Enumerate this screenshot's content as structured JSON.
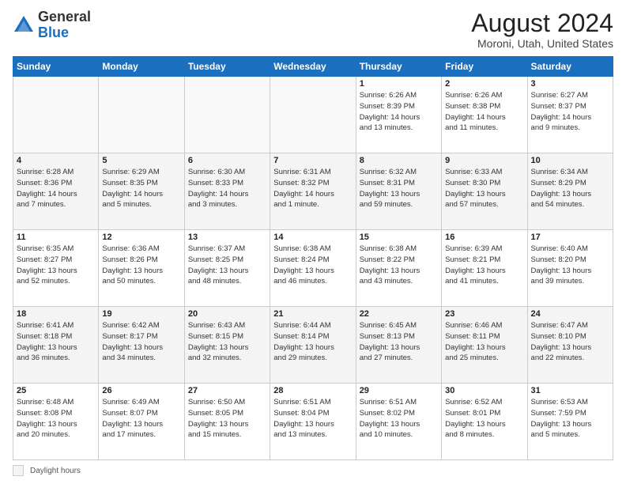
{
  "header": {
    "logo_general": "General",
    "logo_blue": "Blue",
    "month_year": "August 2024",
    "location": "Moroni, Utah, United States"
  },
  "days_of_week": [
    "Sunday",
    "Monday",
    "Tuesday",
    "Wednesday",
    "Thursday",
    "Friday",
    "Saturday"
  ],
  "weeks": [
    [
      {
        "day": "",
        "info": ""
      },
      {
        "day": "",
        "info": ""
      },
      {
        "day": "",
        "info": ""
      },
      {
        "day": "",
        "info": ""
      },
      {
        "day": "1",
        "info": "Sunrise: 6:26 AM\nSunset: 8:39 PM\nDaylight: 14 hours\nand 13 minutes."
      },
      {
        "day": "2",
        "info": "Sunrise: 6:26 AM\nSunset: 8:38 PM\nDaylight: 14 hours\nand 11 minutes."
      },
      {
        "day": "3",
        "info": "Sunrise: 6:27 AM\nSunset: 8:37 PM\nDaylight: 14 hours\nand 9 minutes."
      }
    ],
    [
      {
        "day": "4",
        "info": "Sunrise: 6:28 AM\nSunset: 8:36 PM\nDaylight: 14 hours\nand 7 minutes."
      },
      {
        "day": "5",
        "info": "Sunrise: 6:29 AM\nSunset: 8:35 PM\nDaylight: 14 hours\nand 5 minutes."
      },
      {
        "day": "6",
        "info": "Sunrise: 6:30 AM\nSunset: 8:33 PM\nDaylight: 14 hours\nand 3 minutes."
      },
      {
        "day": "7",
        "info": "Sunrise: 6:31 AM\nSunset: 8:32 PM\nDaylight: 14 hours\nand 1 minute."
      },
      {
        "day": "8",
        "info": "Sunrise: 6:32 AM\nSunset: 8:31 PM\nDaylight: 13 hours\nand 59 minutes."
      },
      {
        "day": "9",
        "info": "Sunrise: 6:33 AM\nSunset: 8:30 PM\nDaylight: 13 hours\nand 57 minutes."
      },
      {
        "day": "10",
        "info": "Sunrise: 6:34 AM\nSunset: 8:29 PM\nDaylight: 13 hours\nand 54 minutes."
      }
    ],
    [
      {
        "day": "11",
        "info": "Sunrise: 6:35 AM\nSunset: 8:27 PM\nDaylight: 13 hours\nand 52 minutes."
      },
      {
        "day": "12",
        "info": "Sunrise: 6:36 AM\nSunset: 8:26 PM\nDaylight: 13 hours\nand 50 minutes."
      },
      {
        "day": "13",
        "info": "Sunrise: 6:37 AM\nSunset: 8:25 PM\nDaylight: 13 hours\nand 48 minutes."
      },
      {
        "day": "14",
        "info": "Sunrise: 6:38 AM\nSunset: 8:24 PM\nDaylight: 13 hours\nand 46 minutes."
      },
      {
        "day": "15",
        "info": "Sunrise: 6:38 AM\nSunset: 8:22 PM\nDaylight: 13 hours\nand 43 minutes."
      },
      {
        "day": "16",
        "info": "Sunrise: 6:39 AM\nSunset: 8:21 PM\nDaylight: 13 hours\nand 41 minutes."
      },
      {
        "day": "17",
        "info": "Sunrise: 6:40 AM\nSunset: 8:20 PM\nDaylight: 13 hours\nand 39 minutes."
      }
    ],
    [
      {
        "day": "18",
        "info": "Sunrise: 6:41 AM\nSunset: 8:18 PM\nDaylight: 13 hours\nand 36 minutes."
      },
      {
        "day": "19",
        "info": "Sunrise: 6:42 AM\nSunset: 8:17 PM\nDaylight: 13 hours\nand 34 minutes."
      },
      {
        "day": "20",
        "info": "Sunrise: 6:43 AM\nSunset: 8:15 PM\nDaylight: 13 hours\nand 32 minutes."
      },
      {
        "day": "21",
        "info": "Sunrise: 6:44 AM\nSunset: 8:14 PM\nDaylight: 13 hours\nand 29 minutes."
      },
      {
        "day": "22",
        "info": "Sunrise: 6:45 AM\nSunset: 8:13 PM\nDaylight: 13 hours\nand 27 minutes."
      },
      {
        "day": "23",
        "info": "Sunrise: 6:46 AM\nSunset: 8:11 PM\nDaylight: 13 hours\nand 25 minutes."
      },
      {
        "day": "24",
        "info": "Sunrise: 6:47 AM\nSunset: 8:10 PM\nDaylight: 13 hours\nand 22 minutes."
      }
    ],
    [
      {
        "day": "25",
        "info": "Sunrise: 6:48 AM\nSunset: 8:08 PM\nDaylight: 13 hours\nand 20 minutes."
      },
      {
        "day": "26",
        "info": "Sunrise: 6:49 AM\nSunset: 8:07 PM\nDaylight: 13 hours\nand 17 minutes."
      },
      {
        "day": "27",
        "info": "Sunrise: 6:50 AM\nSunset: 8:05 PM\nDaylight: 13 hours\nand 15 minutes."
      },
      {
        "day": "28",
        "info": "Sunrise: 6:51 AM\nSunset: 8:04 PM\nDaylight: 13 hours\nand 13 minutes."
      },
      {
        "day": "29",
        "info": "Sunrise: 6:51 AM\nSunset: 8:02 PM\nDaylight: 13 hours\nand 10 minutes."
      },
      {
        "day": "30",
        "info": "Sunrise: 6:52 AM\nSunset: 8:01 PM\nDaylight: 13 hours\nand 8 minutes."
      },
      {
        "day": "31",
        "info": "Sunrise: 6:53 AM\nSunset: 7:59 PM\nDaylight: 13 hours\nand 5 minutes."
      }
    ]
  ],
  "footer": {
    "legend_label": "Daylight hours"
  }
}
